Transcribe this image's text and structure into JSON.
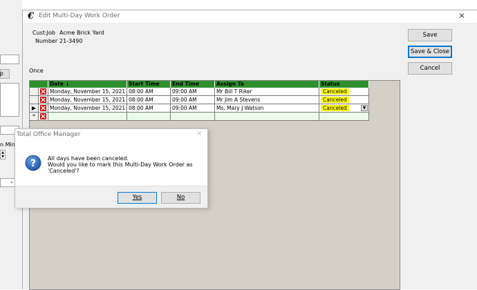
{
  "background_window": {
    "button_fragment": "amp",
    "label_fragment": "n Minu"
  },
  "window": {
    "title": "Edit Multi-Day Work Order"
  },
  "customer": {
    "custjob_label": "Cust:Job",
    "custjob_value": "Acme Brick Yard",
    "number_label": "Number",
    "number_value": "21-3490"
  },
  "recurrence_label": "Once",
  "buttons": {
    "save": "Save",
    "save_close": "Save & Close",
    "cancel": "Cancel"
  },
  "grid": {
    "columns": [
      "Date ↓",
      "Start Time",
      "End Time",
      "Assign To",
      "Status"
    ],
    "rows": [
      {
        "date": "Monday, November 15, 2021",
        "start": "08:00 AM",
        "end": "09:00 AM",
        "assign": "Mr Bill T Riker",
        "status": "Canceled"
      },
      {
        "date": "Monday, November 15, 2021",
        "start": "08:00 AM",
        "end": "09:00 AM",
        "assign": "Mr Jim A Stevens",
        "status": "Canceled"
      },
      {
        "date": "Monday, November 15, 2021",
        "start": "08:00 AM",
        "end": "09:00 AM",
        "assign": "Ms. Mary J Watson",
        "status": "Canceled"
      }
    ],
    "current_row_marker": "▶",
    "new_row_marker": "*"
  },
  "dialog": {
    "title": "Total Office Manager",
    "line1": "All days have been canceled.",
    "line2": "Would you like to mark this Multi-Day Work Order as",
    "line3": "'Canceled'?",
    "yes": "Yes",
    "no": "No"
  }
}
